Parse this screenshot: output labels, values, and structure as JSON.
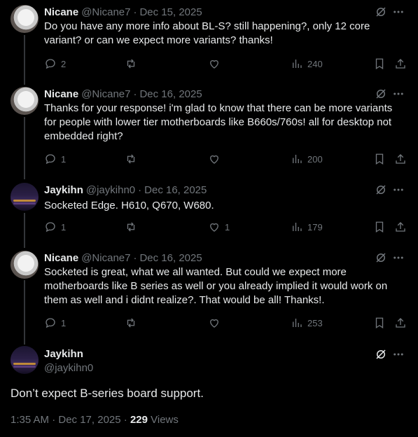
{
  "replies": [
    {
      "name": "Nicane",
      "handle": "@Nicane7",
      "date": "Dec 15, 2025",
      "text": "Do you have any more info about BL-S? still happening?, only 12 core variant? or can we expect more variants? thanks!",
      "replies": "2",
      "reposts": "",
      "likes": "",
      "views": "240",
      "avatar": "cat-avatar"
    },
    {
      "name": "Nicane",
      "handle": "@Nicane7",
      "date": "Dec 16, 2025",
      "text": "Thanks for your response! i'm glad to know that there can be more variants for people with lower tier motherboards like B660s/760s! all for desktop not embedded right?",
      "replies": "1",
      "reposts": "",
      "likes": "",
      "views": "200",
      "avatar": "cat-avatar"
    },
    {
      "name": "Jaykihn",
      "handle": "@jaykihn0",
      "date": "Dec 16, 2025",
      "text": "Socketed Edge. H610, Q670, W680.",
      "replies": "1",
      "reposts": "",
      "likes": "1",
      "views": "179",
      "avatar": "city-avatar"
    },
    {
      "name": "Nicane",
      "handle": "@Nicane7",
      "date": "Dec 16, 2025",
      "text": "Socketed is great, what we all wanted. But could we expect more motherboards like B  series as well or you already implied it would work on them as well and i didnt realize?. That would be all! Thanks!.",
      "replies": "1",
      "reposts": "",
      "likes": "",
      "views": "253",
      "avatar": "cat-avatar"
    }
  ],
  "main": {
    "name": "Jaykihn",
    "handle": "@jaykihn0",
    "text": "Don’t expect B-series board support.",
    "time": "1:35 AM · Dec 17, 2025 · ",
    "views_count": "229",
    "views_label": "Views",
    "avatar": "city-avatar"
  },
  "icons": {
    "reply": "reply-icon",
    "repost": "repost-icon",
    "like": "like-icon",
    "views": "views-icon",
    "bookmark": "bookmark-icon",
    "share": "share-icon",
    "grok": "grok-icon",
    "more": "more-icon"
  },
  "colors": {
    "background": "#000000",
    "text": "#e7e9ea",
    "muted": "#71767b",
    "thread_line": "#333639"
  }
}
